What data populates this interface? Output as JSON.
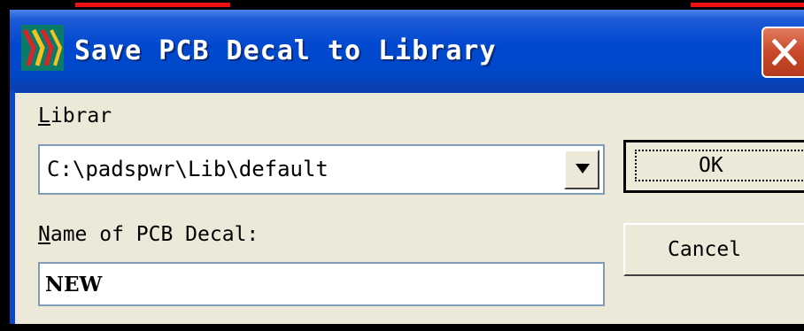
{
  "window": {
    "title": "Save PCB Decal to Library",
    "app_icon": "pads-logo-icon",
    "close_icon": "close-icon"
  },
  "library": {
    "label": "Librar",
    "mnemonic": "L",
    "label_rest": "ibrar",
    "value": "C:\\padspwr\\Lib\\default",
    "dropdown_icon": "chevron-down-icon"
  },
  "decal_name": {
    "label": "Name of PCB Decal:",
    "mnemonic": "N",
    "label_rest": "ame of PCB Decal:",
    "value": "NEW"
  },
  "buttons": {
    "ok": "OK",
    "cancel": "Cancel"
  },
  "colors": {
    "titlebar": "#0048cf",
    "close": "#c9492a",
    "dialog_bg": "#ece9d8",
    "field_border": "#7f9db9"
  }
}
